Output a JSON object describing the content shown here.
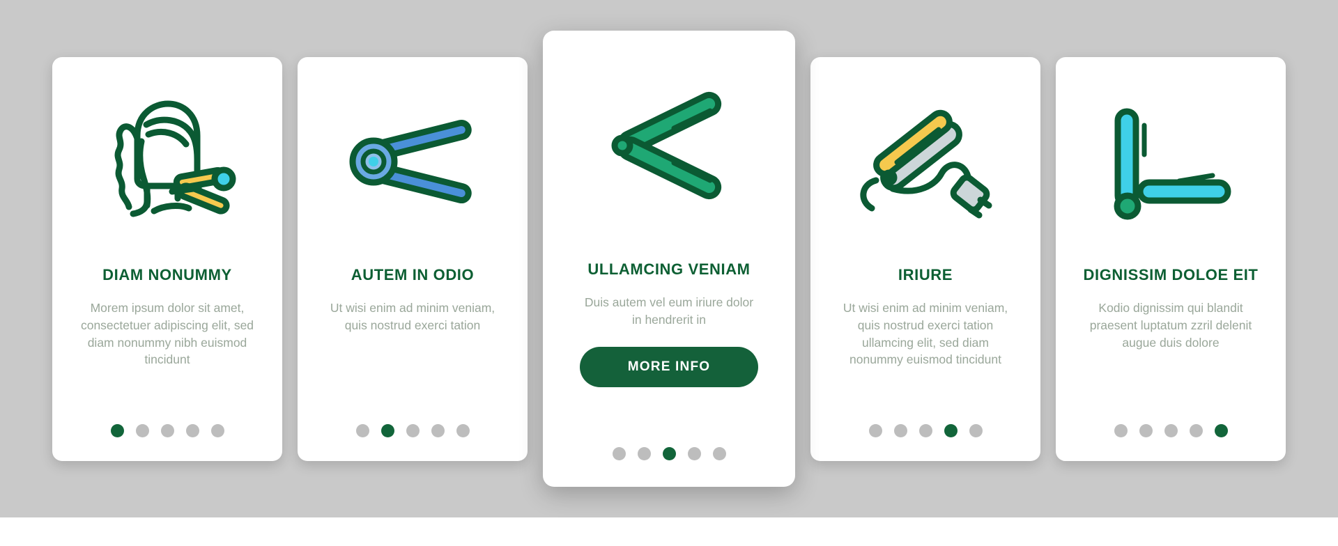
{
  "theme": {
    "background": "#c9c9c9",
    "card_background": "#ffffff",
    "title_color": "#0d5f33",
    "body_color": "#9aa79a",
    "accent_green": "#12653a",
    "dot_inactive": "#bdbdbd",
    "icon_outline": "#0b5a33",
    "icon_yellow": "#f5c94e",
    "icon_blue": "#4a90d9",
    "icon_cyan": "#3fd0e8",
    "icon_green": "#1fa874",
    "icon_grey": "#ccd6d9"
  },
  "cards": [
    {
      "icon": "hair-straightener-head-icon",
      "title": "DIAM NONUMMY",
      "body": "Morem ipsum dolor sit amet, consectetuer adipiscing elit, sed diam nonummy nibh euismod tincidunt",
      "dots": {
        "count": 5,
        "active": 0
      },
      "featured": false,
      "cta": null
    },
    {
      "icon": "hair-straightener-open-blue-icon",
      "title": "AUTEM IN ODIO",
      "body": "Ut wisi enim ad minim veniam, quis nostrud exerci tation",
      "dots": {
        "count": 5,
        "active": 1
      },
      "featured": false,
      "cta": null
    },
    {
      "icon": "hair-straightener-open-green-icon",
      "title": "ULLAMCING VENIAM",
      "body": "Duis autem vel eum iriure dolor in hendrerit in",
      "dots": {
        "count": 5,
        "active": 2
      },
      "featured": true,
      "cta": "MORE INFO"
    },
    {
      "icon": "hair-straightener-cord-plug-icon",
      "title": "IRIURE",
      "body": "Ut wisi enim ad minim veniam, quis nostrud exerci tation ullamcing elit, sed diam nonummy euismod tincidunt",
      "dots": {
        "count": 5,
        "active": 3
      },
      "featured": false,
      "cta": null
    },
    {
      "icon": "hair-straightener-lshape-cyan-icon",
      "title": "DIGNISSIM DOLOE EIT",
      "body": "Kodio dignissim qui blandit praesent luptatum zzril delenit augue duis dolore",
      "dots": {
        "count": 5,
        "active": 4
      },
      "featured": false,
      "cta": null
    }
  ]
}
